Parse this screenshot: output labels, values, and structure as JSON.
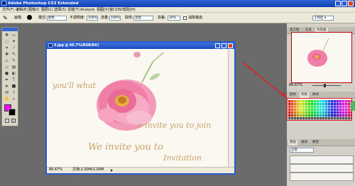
{
  "window": {
    "title": "Adobe Photoshop CS3 Extended"
  },
  "menu": [
    "文件(F)",
    "编辑(E)",
    "图像(I)",
    "图层(L)",
    "选择(S)",
    "滤镜(T)",
    "Analysis",
    "视图(V)",
    "窗口(W)",
    "帮助(H)"
  ],
  "options": {
    "brush_label": "画笔:",
    "mode_label": "模式:",
    "mode_value": "颜色",
    "opacity_label": "不透明度:",
    "opacity_value": "100%",
    "flow_label": "流量:",
    "flow_value": "100%",
    "sample_label": "取样:",
    "sample_value": "连续",
    "tolerance_label": "容差:",
    "tolerance_value": "30%",
    "antialias_label": "消除锯齿",
    "workspace_label": "工作区 ▾"
  },
  "document": {
    "title": "6.jpg @ 66.7%(RGB/8#)",
    "zoom": "66.67%",
    "doc_info": "文档:2.00M/2.00M",
    "script_lines": [
      "you'll what",
      "e invite you to join",
      "We invite you to",
      "Invitation"
    ]
  },
  "panels": {
    "nav_tabs": [
      "直方图",
      "信息",
      "导航器"
    ],
    "nav_zoom": "66.67%",
    "swatch_tabs": [
      "颜色",
      "色板",
      "样式"
    ],
    "layer_tabs": [
      "图层",
      "通道",
      "路径"
    ],
    "layer_mode": "正常"
  },
  "colors": {
    "accent": "#2a5bd0",
    "foreground": "#ff00ff",
    "background": "#000000",
    "highlight_border": "#e02020"
  }
}
